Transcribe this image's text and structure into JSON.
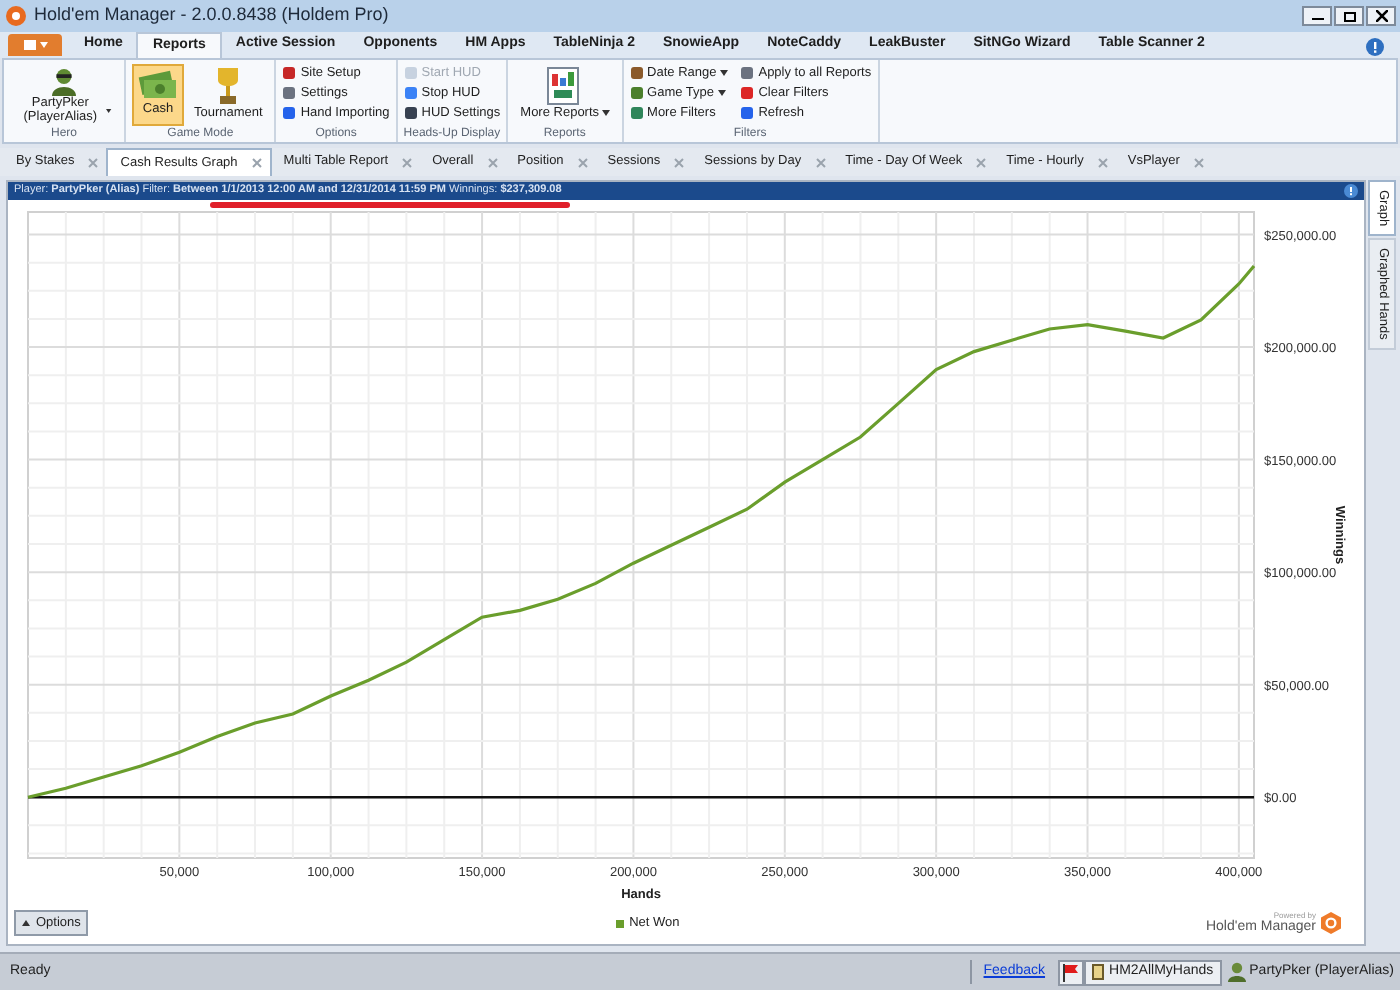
{
  "window": {
    "title": "Hold'em Manager - 2.0.0.8438 (Holdem Pro)"
  },
  "ribbon_tabs": [
    {
      "label": "Home",
      "selected": false
    },
    {
      "label": "Reports",
      "selected": true
    },
    {
      "label": "Active Session",
      "selected": false
    },
    {
      "label": "Opponents",
      "selected": false
    },
    {
      "label": "HM Apps",
      "selected": false
    },
    {
      "label": "TableNinja 2",
      "selected": false
    },
    {
      "label": "SnowieApp",
      "selected": false
    },
    {
      "label": "NoteCaddy",
      "selected": false
    },
    {
      "label": "LeakBuster",
      "selected": false
    },
    {
      "label": "SitNGo Wizard",
      "selected": false
    },
    {
      "label": "Table Scanner 2",
      "selected": false
    }
  ],
  "ribbon_groups": [
    {
      "label": "Hero",
      "kind": "large",
      "items": [
        {
          "label": "PartyPker (PlayerAlias)",
          "dropdown": true
        }
      ]
    },
    {
      "label": "Game Mode",
      "kind": "large",
      "items": [
        {
          "label": "Cash",
          "selected": true
        },
        {
          "label": "Tournament",
          "selected": false
        }
      ]
    },
    {
      "label": "Options",
      "kind": "small",
      "items": [
        {
          "label": "Site Setup",
          "dropdown": false,
          "disabled": false
        },
        {
          "label": "Settings",
          "dropdown": false,
          "disabled": false
        },
        {
          "label": "Hand Importing",
          "dropdown": false,
          "disabled": false
        }
      ]
    },
    {
      "label": "Heads-Up Display",
      "kind": "small",
      "items": [
        {
          "label": "Start HUD",
          "dropdown": false,
          "disabled": true
        },
        {
          "label": "Stop HUD",
          "dropdown": false,
          "disabled": false
        },
        {
          "label": "HUD Settings",
          "dropdown": false,
          "disabled": false
        }
      ]
    },
    {
      "label": "Reports",
      "kind": "large",
      "items": [
        {
          "label": "More Reports",
          "dropdown": true
        }
      ]
    },
    {
      "label": "Filters",
      "kind": "small",
      "items": [
        {
          "label": "Date Range",
          "dropdown": true,
          "disabled": false
        },
        {
          "label": "Game Type",
          "dropdown": true,
          "disabled": false
        },
        {
          "label": "More Filters",
          "dropdown": false,
          "disabled": false
        },
        {
          "label": "Apply to all Reports",
          "dropdown": false,
          "disabled": false
        },
        {
          "label": "Clear Filters",
          "dropdown": false,
          "disabled": false
        },
        {
          "label": "Refresh",
          "dropdown": false,
          "disabled": false
        }
      ]
    }
  ],
  "report_tabs": [
    {
      "label": "By Stakes",
      "selected": false
    },
    {
      "label": "Cash Results Graph",
      "selected": true
    },
    {
      "label": "Multi Table Report",
      "selected": false
    },
    {
      "label": "Overall",
      "selected": false
    },
    {
      "label": "Position",
      "selected": false
    },
    {
      "label": "Sessions",
      "selected": false
    },
    {
      "label": "Sessions by Day",
      "selected": false
    },
    {
      "label": "Time - Day Of Week",
      "selected": false
    },
    {
      "label": "Time - Hourly",
      "selected": false
    },
    {
      "label": "VsPlayer",
      "selected": false
    }
  ],
  "filter_bar": {
    "text": "Player: **PartyPker (Alias)** Filter: **Between 1/1/2013 12:00 AM and 12/31/2014 11:59 PM** Winnings: **$237,309.08**"
  },
  "chart": {
    "chart_data": {
      "type": "line",
      "grid": true,
      "xlabel": "Hands",
      "ylabel": "Winnings",
      "xlim": [
        0,
        405000
      ],
      "ylim": [
        -27000,
        260000
      ],
      "xticks": [
        {
          "value": 50000,
          "label": "50,000"
        },
        {
          "value": 100000,
          "label": "100,000"
        },
        {
          "value": 150000,
          "label": "150,000"
        },
        {
          "value": 200000,
          "label": "200,000"
        },
        {
          "value": 250000,
          "label": "250,000"
        },
        {
          "value": 300000,
          "label": "300,000"
        },
        {
          "value": 350000,
          "label": "350,000"
        },
        {
          "value": 400000,
          "label": "400,000"
        }
      ],
      "yticks": [
        {
          "value": 0,
          "label": "$0.00"
        },
        {
          "value": 50000,
          "label": "$50,000.00"
        },
        {
          "value": 100000,
          "label": "$100,000.00"
        },
        {
          "value": 150000,
          "label": "$150,000.00"
        },
        {
          "value": 200000,
          "label": "$200,000.00"
        },
        {
          "value": 250000,
          "label": "$250,000.00"
        }
      ],
      "x": [
        0,
        12500,
        25000,
        37500,
        50000,
        62500,
        75000,
        87500,
        100000,
        112500,
        125000,
        137500,
        150000,
        162500,
        175000,
        187500,
        200000,
        212500,
        225000,
        237500,
        250000,
        262500,
        275000,
        287500,
        300000,
        312500,
        325000,
        337500,
        350000,
        362500,
        375000,
        387500,
        400000,
        405000
      ],
      "series": [
        {
          "name": "Net Won",
          "color": "#6a9e2c",
          "values": [
            0,
            4000,
            9000,
            14000,
            20000,
            27000,
            33000,
            37000,
            45000,
            52000,
            60000,
            70000,
            80000,
            83000,
            88000,
            95000,
            104000,
            112000,
            120000,
            128000,
            140000,
            150000,
            160000,
            175000,
            190000,
            198000,
            203000,
            208000,
            210000,
            207000,
            204000,
            212000,
            228000,
            236000
          ]
        }
      ]
    },
    "options_button": "Options",
    "branding_caption": "Powered by",
    "branding_name": "Hold'em Manager"
  },
  "side_tabs": [
    {
      "label": "Graph",
      "selected": true
    },
    {
      "label": "Graphed Hands",
      "selected": false
    }
  ],
  "status_bar": {
    "status": "Ready",
    "link": "Feedback",
    "database": "HM2AllMyHands",
    "player": "PartyPker (PlayerAlias)"
  }
}
